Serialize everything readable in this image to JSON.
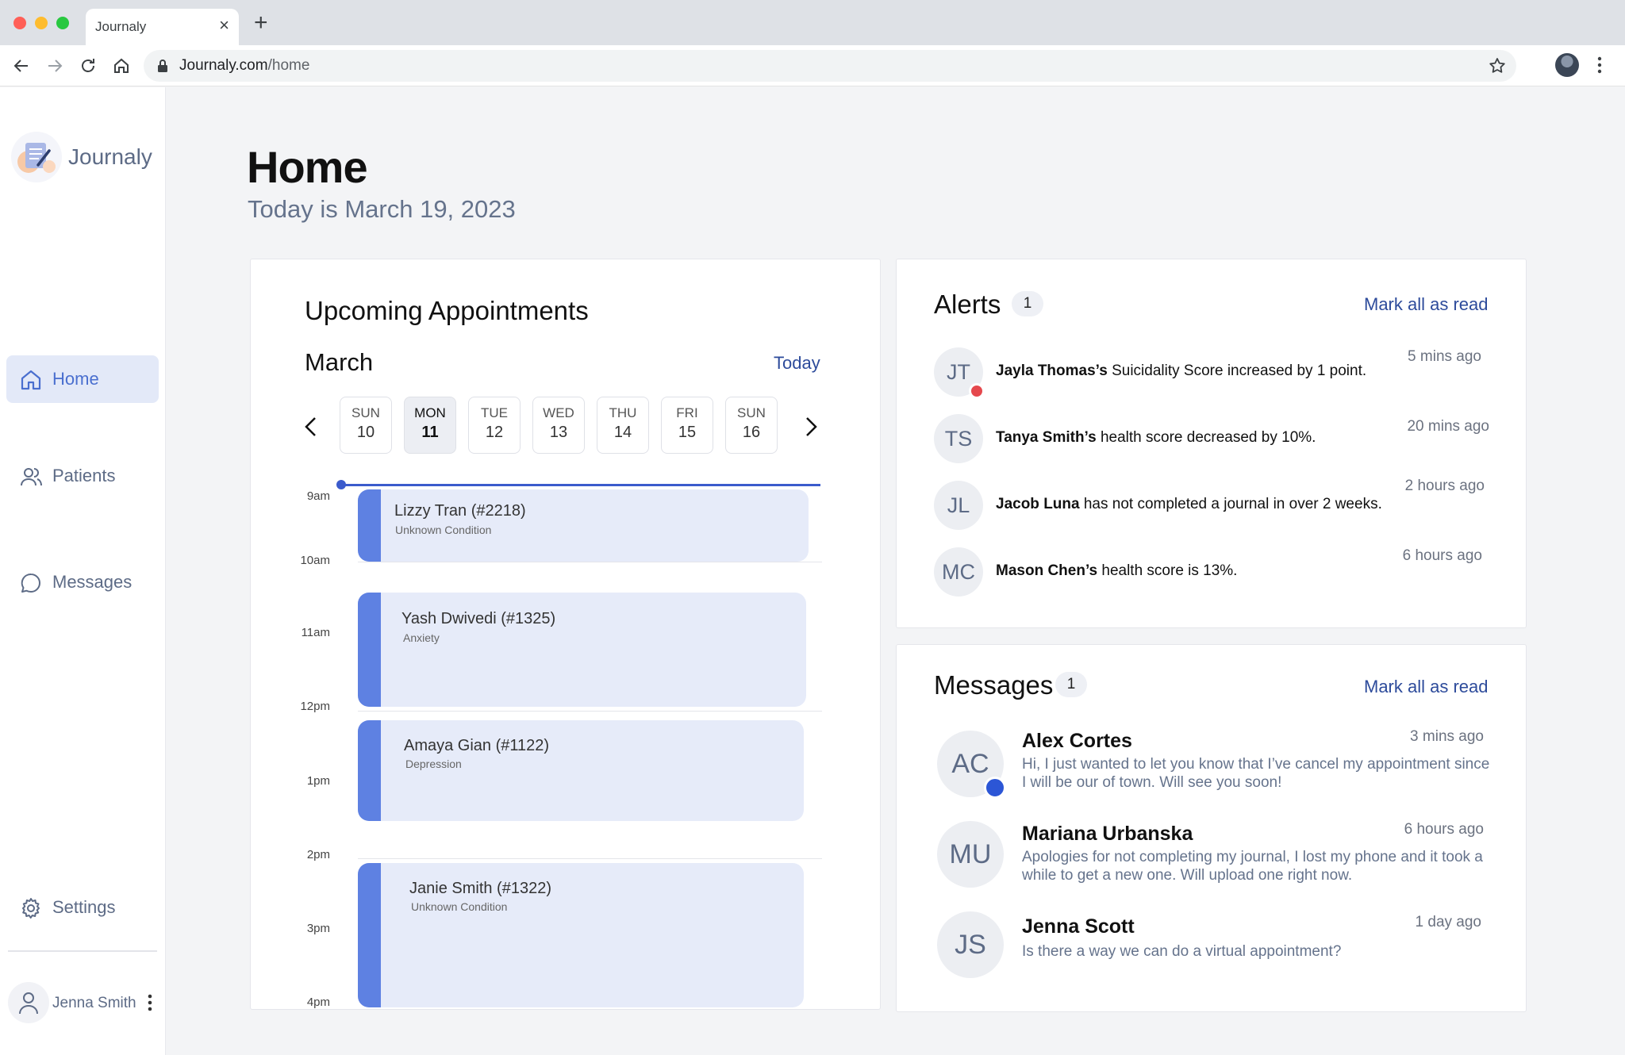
{
  "browser": {
    "tab_title": "Journaly",
    "tab_close": "×",
    "new_tab": "+",
    "url_host": "Journaly.com",
    "url_path": "/home"
  },
  "sidebar": {
    "brand": "Journaly",
    "items": [
      {
        "label": "Home",
        "icon": "home-icon",
        "active": true
      },
      {
        "label": "Patients",
        "icon": "users-icon",
        "active": false
      },
      {
        "label": "Messages",
        "icon": "chat-icon",
        "active": false
      },
      {
        "label": "Settings",
        "icon": "gear-icon",
        "active": false
      }
    ],
    "user_name": "Jenna Smith"
  },
  "header": {
    "title": "Home",
    "subtitle": "Today is March 19, 2023"
  },
  "appointments": {
    "heading": "Upcoming Appointments",
    "month": "March",
    "today_link": "Today",
    "days": [
      {
        "name": "SUN",
        "num": "10",
        "selected": false
      },
      {
        "name": "MON",
        "num": "11",
        "selected": true
      },
      {
        "name": "TUE",
        "num": "12",
        "selected": false
      },
      {
        "name": "WED",
        "num": "13",
        "selected": false
      },
      {
        "name": "THU",
        "num": "14",
        "selected": false
      },
      {
        "name": "FRI",
        "num": "15",
        "selected": false
      },
      {
        "name": "SUN",
        "num": "16",
        "selected": false
      }
    ],
    "hours": [
      "9am",
      "10am",
      "11am",
      "12pm",
      "1pm",
      "2pm",
      "3pm",
      "4pm"
    ],
    "items": [
      {
        "name": "Lizzy Tran (#2218)",
        "condition": "Unknown Condition"
      },
      {
        "name": "Yash Dwivedi (#1325)",
        "condition": "Anxiety"
      },
      {
        "name": "Amaya Gian (#1122)",
        "condition": "Depression"
      },
      {
        "name": "Janie Smith (#1322)",
        "condition": "Unknown Condition"
      }
    ]
  },
  "alerts": {
    "heading": "Alerts",
    "count": "1",
    "mark_read": "Mark all as read",
    "items": [
      {
        "initials": "JT",
        "name": "Jayla Thomas’s",
        "text": " Suicidality Score increased by 1  point.",
        "time": "5 mins ago",
        "dot_color": "#e5484d"
      },
      {
        "initials": "TS",
        "name": "Tanya Smith’s",
        "text": " health score decreased by 10%.",
        "time": "20 mins ago"
      },
      {
        "initials": "JL",
        "name": "Jacob Luna",
        "text": " has not completed a journal in over 2 weeks.",
        "time": "2 hours ago"
      },
      {
        "initials": "MC",
        "name": "Mason Chen’s",
        "text": " health score is 13%.",
        "time": "6 hours ago"
      }
    ]
  },
  "messages": {
    "heading": "Messages",
    "count": "1",
    "mark_read": "Mark all as read",
    "items": [
      {
        "initials": "AC",
        "name": "Alex Cortes",
        "body": "Hi, I just wanted to let you know that I’ve cancel my appointment since I will be our of town. Will see you soon!",
        "time": "3 mins ago",
        "dot_color": "#2c56d6"
      },
      {
        "initials": "MU",
        "name": "Mariana Urbanska",
        "body": "Apologies for not completing my journal, I lost my phone and it took a while to get a new one. Will upload one right now.",
        "time": "6 hours ago"
      },
      {
        "initials": "JS",
        "name": "Jenna Scott",
        "body": "Is there a way we can do a virtual appointment?",
        "time": "1 day ago"
      }
    ]
  },
  "colors": {
    "accent": "#4a6fcf",
    "link": "#2d4b9b",
    "appointment_bar": "#5e81e2",
    "appointment_bg": "#e6ebf9",
    "now_line": "#3b5bcc"
  }
}
